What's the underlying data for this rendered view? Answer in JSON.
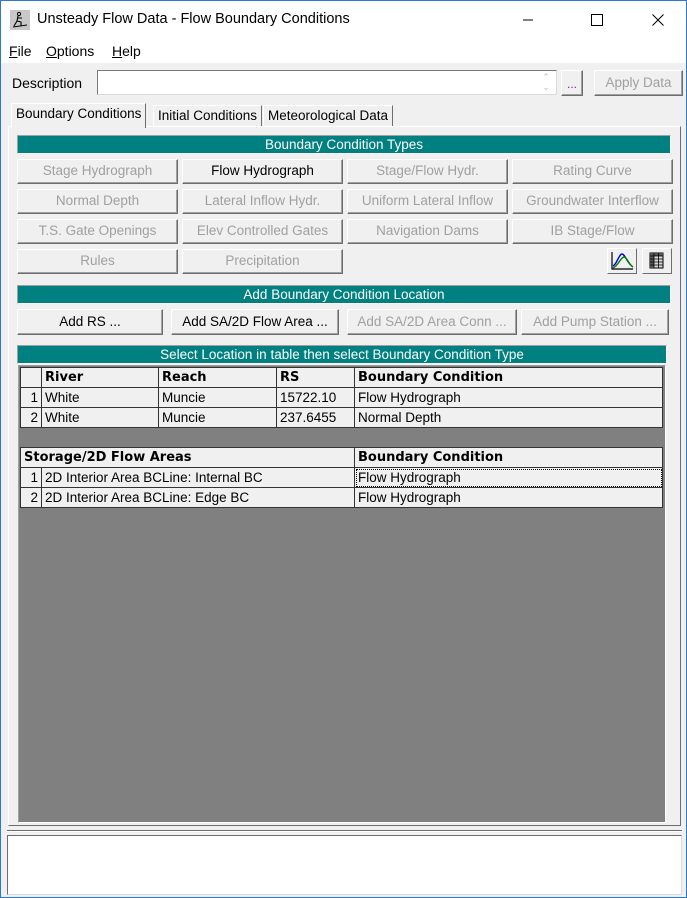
{
  "window": {
    "title": "Unsteady Flow Data - Flow Boundary Conditions",
    "icon": "hec-ras-person-icon",
    "controls": [
      "minimize",
      "maximize",
      "close"
    ]
  },
  "menu": {
    "items": [
      {
        "label": "File",
        "mnemonic": "F",
        "rest": "ile"
      },
      {
        "label": "Options",
        "mnemonic": "O",
        "rest": "ptions"
      },
      {
        "label": "Help",
        "mnemonic": "H",
        "rest": "elp"
      }
    ]
  },
  "description": {
    "label": "Description",
    "value": "",
    "browse_label": "...",
    "apply_label": "Apply Data",
    "apply_enabled": false
  },
  "tabs": [
    {
      "label": "Boundary Conditions",
      "active": true
    },
    {
      "label": "Initial Conditions",
      "active": false
    },
    {
      "label": "Meteorological Data",
      "active": false
    }
  ],
  "bc_types": {
    "header": "Boundary Condition Types",
    "buttons": [
      {
        "label": "Stage Hydrograph",
        "enabled": false
      },
      {
        "label": "Flow Hydrograph",
        "enabled": true
      },
      {
        "label": "Stage/Flow Hydr.",
        "enabled": false
      },
      {
        "label": "Rating Curve",
        "enabled": false
      },
      {
        "label": "Normal Depth",
        "enabled": false
      },
      {
        "label": "Lateral Inflow Hydr.",
        "enabled": false
      },
      {
        "label": "Uniform Lateral Inflow",
        "enabled": false
      },
      {
        "label": "Groundwater Interflow",
        "enabled": false
      },
      {
        "label": "T.S. Gate Openings",
        "enabled": false
      },
      {
        "label": "Elev Controlled Gates",
        "enabled": false
      },
      {
        "label": "Navigation Dams",
        "enabled": false
      },
      {
        "label": "IB Stage/Flow",
        "enabled": false
      },
      {
        "label": "Rules",
        "enabled": false
      },
      {
        "label": "Precipitation",
        "enabled": false
      }
    ],
    "icon_buttons": [
      "plot-hydrograph-icon",
      "table-icon"
    ]
  },
  "add_location": {
    "header": "Add Boundary Condition Location",
    "buttons": [
      {
        "label": "Add RS ...",
        "enabled": true
      },
      {
        "label": "Add SA/2D Flow Area ...",
        "enabled": true
      },
      {
        "label": "Add SA/2D Area Conn ...",
        "enabled": false
      },
      {
        "label": "Add Pump Station ...",
        "enabled": false
      }
    ]
  },
  "location_table": {
    "header": "Select Location in table then select Boundary Condition Type",
    "river_table": {
      "columns": [
        "",
        "River",
        "Reach",
        "RS",
        "Boundary Condition"
      ],
      "rows": [
        {
          "num": "1",
          "river": "White",
          "reach": "Muncie",
          "rs": "15722.10",
          "bc": "Flow Hydrograph"
        },
        {
          "num": "2",
          "river": "White",
          "reach": "Muncie",
          "rs": "237.6455",
          "bc": "Normal Depth"
        }
      ]
    },
    "storage_table": {
      "columns": [
        "Storage/2D Flow Areas",
        "Boundary Condition"
      ],
      "rows": [
        {
          "num": "1",
          "name": "2D Interior Area BCLine: Internal BC",
          "bc": "Flow Hydrograph",
          "focused": true
        },
        {
          "num": "2",
          "name": "2D Interior Area BCLine: Edge BC",
          "bc": "Flow Hydrograph",
          "focused": false
        }
      ]
    }
  },
  "message_box": {
    "text": ""
  },
  "colors": {
    "teal_header": "#008080",
    "grid_background": "#808080",
    "window_border": "#2b78d0"
  }
}
